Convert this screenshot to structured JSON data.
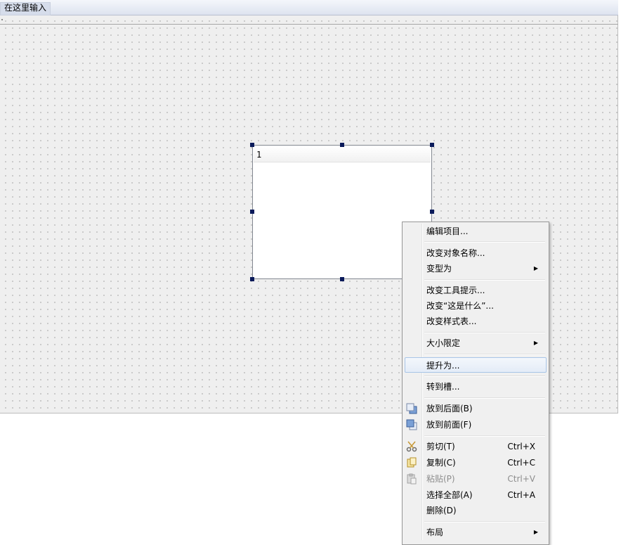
{
  "form": {
    "menubar_placeholder": "在这里输入"
  },
  "list_widget": {
    "items": [
      "1"
    ]
  },
  "context_menu": {
    "edit_items": "编辑项目...",
    "change_object_name": "改变对象名称...",
    "morph_into": "变型为",
    "change_tooltip": "改变工具提示...",
    "change_whats_this": "改变“这是什么”...",
    "change_stylesheet": "改变样式表...",
    "size_constraints": "大小限定",
    "promote_to": "提升为...",
    "go_to_slot": "转到槽...",
    "send_to_back": "放到后面(B)",
    "bring_to_front": "放到前面(F)",
    "cut": "剪切(T)",
    "cut_shortcut": "Ctrl+X",
    "copy": "复制(C)",
    "copy_shortcut": "Ctrl+C",
    "paste": "粘贴(P)",
    "paste_shortcut": "Ctrl+V",
    "select_all": "选择全部(A)",
    "select_all_shortcut": "Ctrl+A",
    "delete": "删除(D)",
    "layout": "布局"
  },
  "colors": {
    "selection_handle": "#0a1a5a",
    "menu_highlight": "#e4ecf7",
    "menu_highlight_border": "#a8c5e7"
  }
}
